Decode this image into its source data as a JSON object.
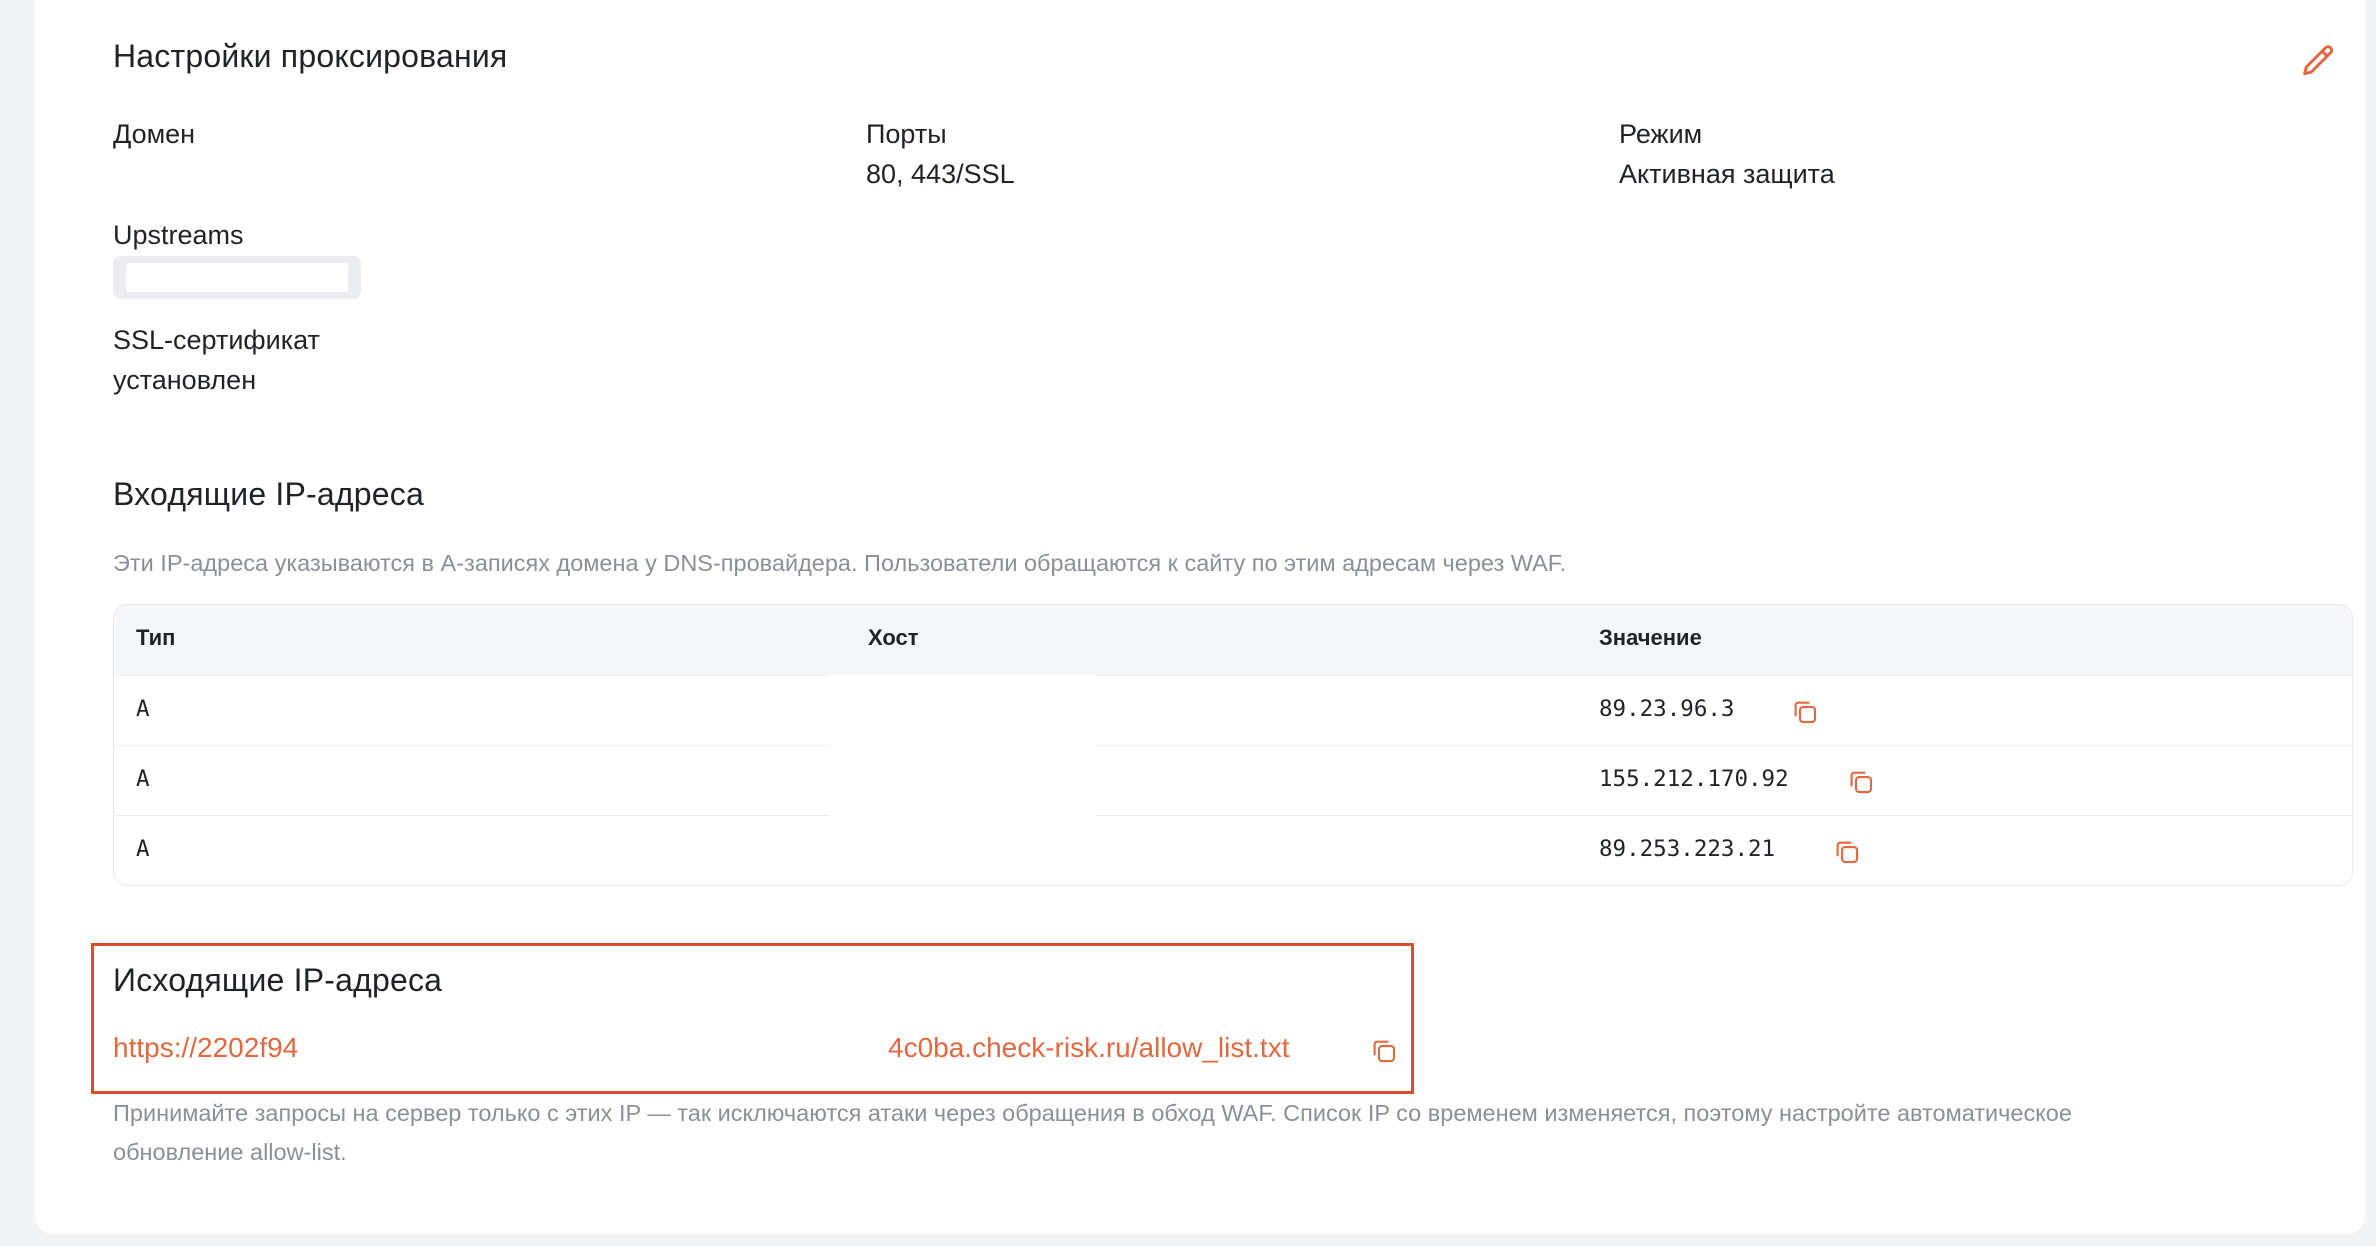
{
  "proxy": {
    "title": "Настройки проксирования",
    "domain_label": "Домен",
    "ports_label": "Порты",
    "ports_value": "80, 443/SSL",
    "mode_label": "Режим",
    "mode_value": "Активная защита",
    "upstreams_label": "Upstreams",
    "ssl_label": "SSL-сертификат",
    "ssl_value": "установлен",
    "edit_icon": "pencil-icon"
  },
  "incoming": {
    "title": "Входящие IP-адреса",
    "description": "Эти IP-адреса указываются в A-записях домена у DNS-провайдера. Пользователи обращаются к сайту по этим адресам через WAF.",
    "columns": {
      "type": "Тип",
      "host": "Хост",
      "value": "Значение"
    },
    "rows": [
      {
        "type": "A",
        "value": "89.23.96.3"
      },
      {
        "type": "A",
        "value": "155.212.170.92"
      },
      {
        "type": "A",
        "value": "89.253.223.21"
      }
    ]
  },
  "outgoing": {
    "title": "Исходящие IP-адреса",
    "link_start": "https://2202f94",
    "link_end": "4c0ba.check-risk.ru/allow_list.txt",
    "description_line1": "Принимайте запросы на сервер только с этих IP — так исключаются атаки через обращения в обход WAF. Список IP со временем изменяется, поэтому настройте автоматическое",
    "description_line2": "обновление allow-list."
  },
  "colors": {
    "accent": "#e0693f",
    "highlight": "#e04b2e",
    "muted": "#8b9098"
  }
}
